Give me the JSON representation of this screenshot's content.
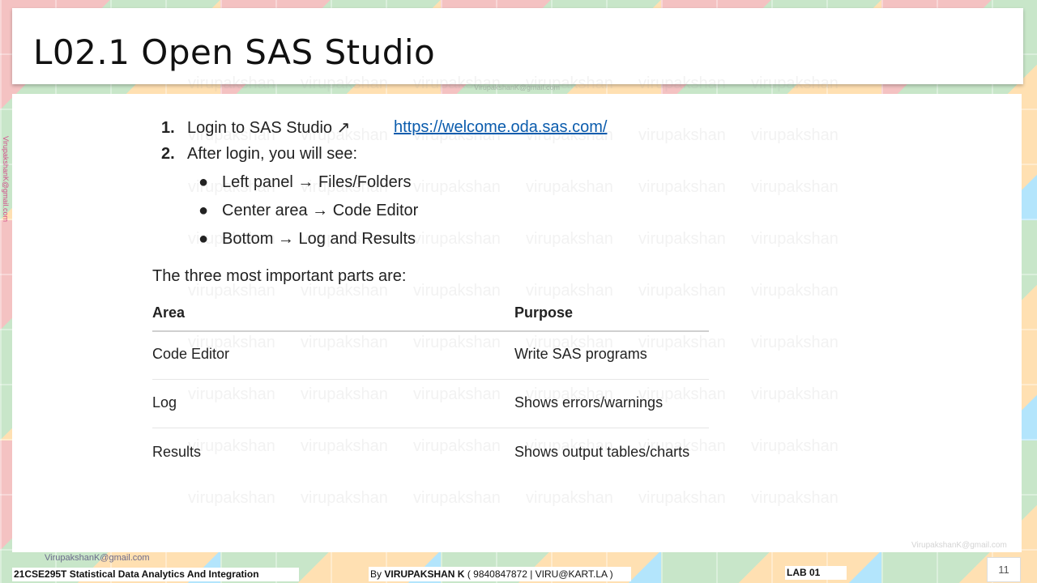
{
  "slide": {
    "title": "L02.1 Open SAS Studio",
    "page_number": "11"
  },
  "steps": [
    {
      "number": "1.",
      "text": "Login to SAS Studio ↗"
    },
    {
      "number": "2.",
      "text": "After login, you will see:"
    }
  ],
  "link": "https://welcome.oda.sas.com/",
  "bullets": [
    "Left panel → Files/Folders",
    "Center area → Code Editor",
    "Bottom → Log and Results"
  ],
  "intro": "The three most important parts are:",
  "table": {
    "headers": [
      "Area",
      "Purpose"
    ],
    "rows": [
      [
        "Code Editor",
        "Write SAS programs"
      ],
      [
        "Log",
        "Shows errors/warnings"
      ],
      [
        "Results",
        "Shows output tables/charts"
      ]
    ]
  },
  "watermark": "virupakshan",
  "footer": {
    "email": "VirupakshanK@gmail.com",
    "vertical_email": "VirupakshanK@gmail.com",
    "course": "21CSE295T Statistical Data Analytics And Integration",
    "author_prefix": "By",
    "author_name": "VIRUPAKSHAN K",
    "author_contact": "( 9840847872 | VIRU@KART.LA )",
    "lab": "LAB  01"
  }
}
